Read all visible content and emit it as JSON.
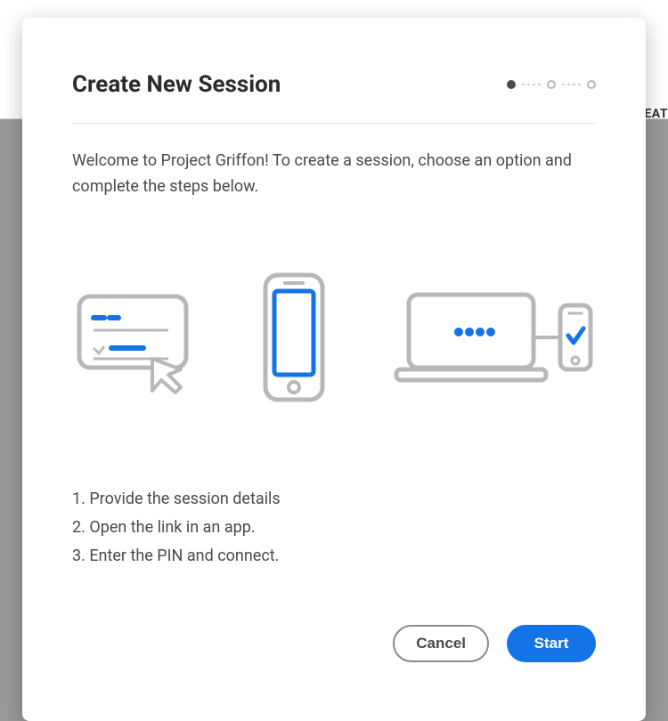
{
  "background": {
    "partial_button_text": "EAT"
  },
  "modal": {
    "title": "Create New Session",
    "intro": "Welcome to Project Griffon! To create a session, choose an option and complete the steps below.",
    "steps": [
      "1. Provide the session details",
      "2. Open the link in an app.",
      "3. Enter the PIN and connect."
    ],
    "stepper": {
      "current": 1,
      "total": 3
    },
    "buttons": {
      "cancel": "Cancel",
      "start": "Start"
    }
  }
}
